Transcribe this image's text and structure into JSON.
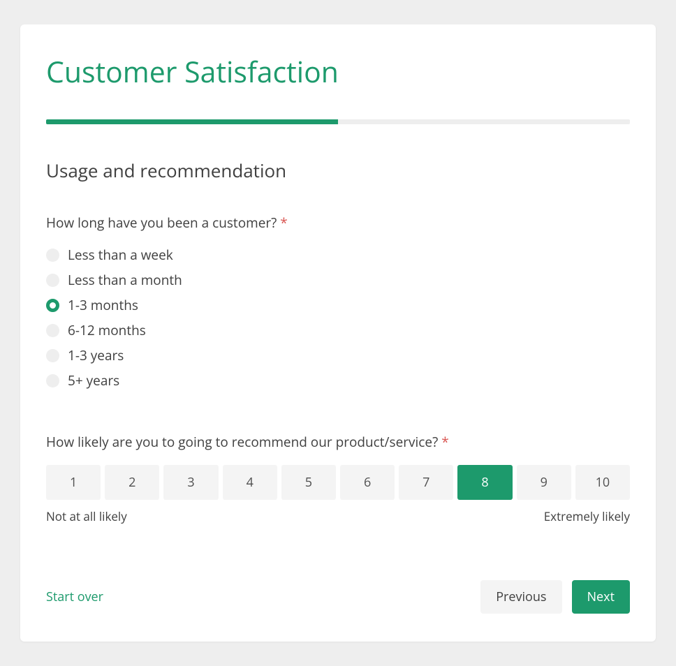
{
  "title": "Customer Satisfaction",
  "progress_percent": 50,
  "section_title": "Usage and recommendation",
  "q1": {
    "label": "How long have you been a customer?",
    "required_marker": "*",
    "options": [
      "Less than a week",
      "Less than a month",
      "1-3 months",
      "6-12 months",
      "1-3 years",
      "5+ years"
    ],
    "selected_index": 2
  },
  "q2": {
    "label": "How likely are you to going to recommend our product/service?",
    "required_marker": "*",
    "min": 1,
    "max": 10,
    "min_label": "Not at all likely",
    "max_label": "Extremely likely",
    "selected_value": 8
  },
  "footer": {
    "start_over": "Start over",
    "previous": "Previous",
    "next": "Next"
  }
}
